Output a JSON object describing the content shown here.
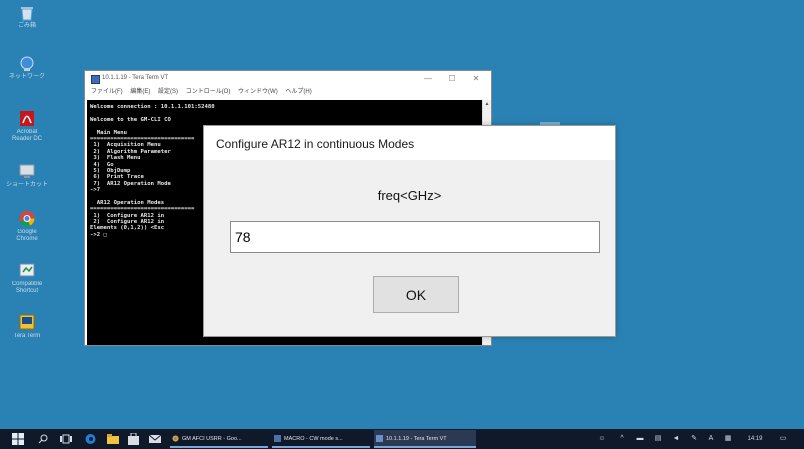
{
  "desktop_icons": [
    {
      "id": "recycle",
      "label": "ごみ箱"
    },
    {
      "id": "network",
      "label": "ネットワーク"
    },
    {
      "id": "acrobat",
      "label": "Acrobat Reader DC"
    },
    {
      "id": "shortcut",
      "label": "ショートカット"
    },
    {
      "id": "chrome",
      "label": "Google Chrome"
    },
    {
      "id": "compatible",
      "label": "Compatible Shortcut"
    },
    {
      "id": "teraterm",
      "label": "Tera Term"
    }
  ],
  "teraterm": {
    "title": "10.1.1.19 - Tera Term VT",
    "minimize": "—",
    "maximize": "☐",
    "close": "✕",
    "menu": [
      "ファイル(F)",
      "編集(E)",
      "設定(S)",
      "コントロール(O)",
      "ウィンドウ(W)",
      "ヘルプ(H)"
    ],
    "lines": [
      "Welcome connection : 10.1.1.101:52480",
      "",
      "Welcome to the GM-CLI CO",
      "",
      "  Main Menu",
      "===============================",
      " 1)  Acquisition Menu",
      " 2)  Algorithm Parameter",
      " 3)  Flash Menu",
      " 4)  Go",
      " 5)  ObjDump",
      " 6)  Print Trace",
      " 7)  AR12 Operation Mode",
      "->7",
      "",
      "  AR12 Operation Modes",
      "===============================",
      " 1)  Configure AR12 in",
      " 2)  Configure AR12 in",
      "Elements (0,1,2)) <Esc",
      "->2 □"
    ]
  },
  "dialog": {
    "title": "Configure AR12 in continuous Modes",
    "label": "freq<GHz>",
    "value": "78",
    "ok_label": "OK"
  },
  "taskbar": {
    "tasks": [
      {
        "label": "GM AFCI USRR - Goo...",
        "icon_color": "#e0a52b"
      },
      {
        "label": "MACRO - CW mode s...",
        "icon_color": "#4f6fa8"
      },
      {
        "label": "10.1.1.19 - Tera Term VT",
        "icon_color": "#6a8fc8"
      }
    ],
    "ime": "A",
    "clock": "14:19"
  }
}
